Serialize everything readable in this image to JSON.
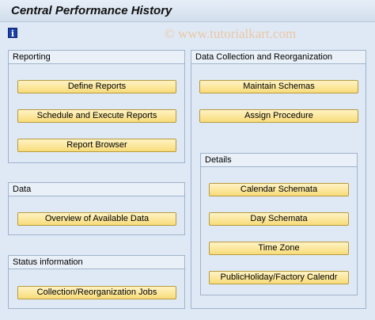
{
  "window": {
    "title": "Central Performance History"
  },
  "toolbar": {
    "info_icon": "info-icon"
  },
  "watermark": "© www.tutorialkart.com",
  "groups": {
    "reporting": {
      "header": "Reporting",
      "buttons": [
        "Define Reports",
        "Schedule and Execute Reports",
        "Report Browser"
      ]
    },
    "data": {
      "header": "Data",
      "buttons": [
        "Overview of Available Data"
      ]
    },
    "status": {
      "header": "Status information",
      "buttons": [
        "Collection/Reorganization Jobs"
      ]
    },
    "collection": {
      "header": "Data Collection and Reorganization",
      "buttons": [
        "Maintain Schemas",
        "Assign Procedure"
      ]
    },
    "details": {
      "header": "Details",
      "buttons": [
        "Calendar Schemata",
        "Day Schemata",
        "Time Zone",
        "PublicHoliday/Factory Calendr"
      ]
    }
  }
}
